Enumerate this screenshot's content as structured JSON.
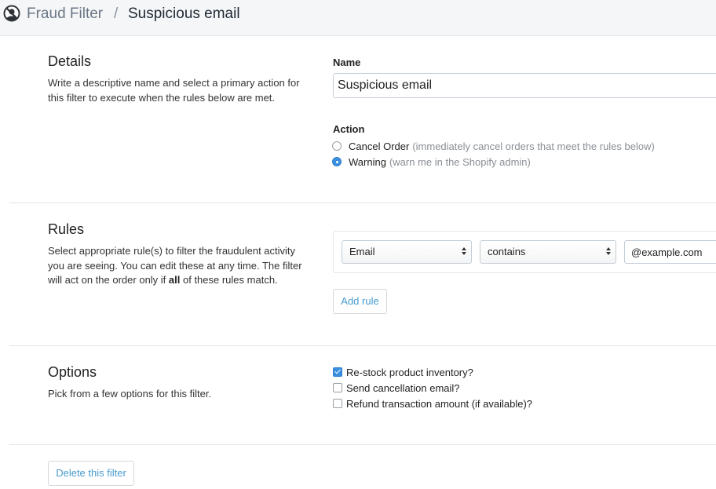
{
  "breadcrumb": {
    "app_icon": "fraud-filter-icon",
    "app": "Fraud Filter",
    "separator": "/",
    "page": "Suspicious email"
  },
  "details": {
    "title": "Details",
    "description": "Write a descriptive name and select a primary action for this filter to execute when the rules below are met.",
    "name_label": "Name",
    "name_value": "Suspicious email",
    "action_label": "Action",
    "actions": [
      {
        "label": "Cancel Order",
        "hint": "(immediately cancel orders that meet the rules below)",
        "selected": false
      },
      {
        "label": "Warning",
        "hint": "(warn me in the Shopify admin)",
        "selected": true
      }
    ]
  },
  "rules": {
    "title": "Rules",
    "description_before": "Select appropriate rule(s) to filter the fraudulent activity you are seeing. You can edit these at any time. The filter will act on the order only if ",
    "description_emphasis": "all",
    "description_after": " of these rules match.",
    "items": [
      {
        "field": "Email",
        "operator": "contains",
        "value": "@example.com"
      }
    ],
    "add_rule_label": "Add rule"
  },
  "options": {
    "title": "Options",
    "description": "Pick from a few options for this filter.",
    "items": [
      {
        "label": "Re-stock product inventory?",
        "checked": true
      },
      {
        "label": "Send cancellation email?",
        "checked": false
      },
      {
        "label": "Refund transaction amount (if available)?",
        "checked": false
      }
    ]
  },
  "footer": {
    "delete_label": "Delete this filter"
  },
  "colors": {
    "accent": "#3b8fe0",
    "link": "#479ccf",
    "header_bg": "#f5f6f7"
  }
}
